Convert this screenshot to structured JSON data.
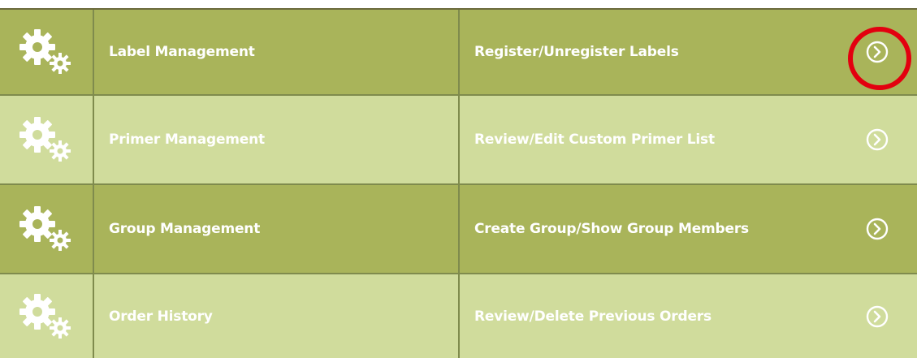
{
  "menu": {
    "rows": [
      {
        "title": "Label Management",
        "action": "Register/Unregister Labels",
        "icon": "gears-icon",
        "arrow_icon": "chevron-circle-right-icon",
        "highlighted": true
      },
      {
        "title": "Primer Management",
        "action": "Review/Edit Custom Primer List",
        "icon": "gears-icon",
        "arrow_icon": "chevron-circle-right-icon",
        "highlighted": false
      },
      {
        "title": "Group Management",
        "action": "Create Group/Show Group Members",
        "icon": "gears-icon",
        "arrow_icon": "chevron-circle-right-icon",
        "highlighted": false
      },
      {
        "title": "Order History",
        "action": "Review/Delete Previous Orders",
        "icon": "gears-icon",
        "arrow_icon": "chevron-circle-right-icon",
        "highlighted": false
      }
    ]
  },
  "colors": {
    "row_dark": "#a9b45a",
    "row_light": "#d0dc9c",
    "text": "#ffffff",
    "highlight": "#e3000f"
  }
}
